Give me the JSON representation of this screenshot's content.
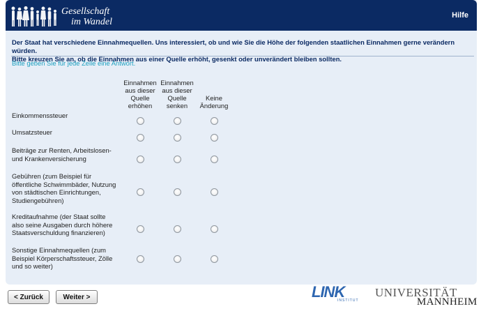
{
  "header": {
    "brand_line1": "Gesellschaft",
    "brand_line2": "im Wandel",
    "help": "Hilfe"
  },
  "intro": {
    "line1": "Der Staat hat verschiedene Einnahmequellen. Uns interessiert, ob und wie Sie die Höhe der folgenden staatlichen Einnahmen gerne verändern würden.",
    "line2": "Bitte kreuzen Sie an, ob die Einnahmen aus einer Quelle erhöht, gesenkt oder unverändert bleiben sollten."
  },
  "instruction": "Bitte geben Sie für jede Zeile eine Antwort.",
  "columns": [
    {
      "lines": [
        "Einnahmen",
        "aus dieser",
        "Quelle",
        "erhöhen"
      ]
    },
    {
      "lines": [
        "Einnahmen",
        "aus dieser",
        "Quelle",
        "senken"
      ]
    },
    {
      "lines": [
        "Keine",
        "Änderung"
      ]
    }
  ],
  "rows": [
    {
      "lines": [
        "Einkommenssteuer"
      ]
    },
    {
      "lines": [
        "Umsatzsteuer"
      ]
    },
    {
      "lines": [
        "Beiträge zur Renten, Arbeitslosen-",
        "und Krankenversicherung"
      ]
    },
    {
      "lines": [
        "Gebühren (zum Beispiel für",
        "öffentliche Schwimmbäder, Nutzung",
        "von städtischen Einrichtungen,",
        "Studiengebühren)"
      ]
    },
    {
      "lines": [
        "Kreditaufnahme (der Staat sollte",
        "also seine Ausgaben durch höhere",
        "Staatsverschuldung finanzieren)"
      ]
    },
    {
      "lines": [
        "Sonstige Einnahmequellen (zum",
        "Beispiel Körperschaftssteuer, Zölle",
        "und so weiter)"
      ]
    }
  ],
  "buttons": {
    "back": "< Zurück",
    "next": "Weiter >"
  },
  "footer": {
    "link_logo": "LINK",
    "link_sub": "INSTITUT",
    "uni_line1": "UNIVERSITÄT",
    "uni_line2": "MANNHEIM"
  },
  "colors": {
    "header_bg": "#0b2a63",
    "page_bg": "#e7eef7",
    "instruction": "#1a9fbf"
  }
}
